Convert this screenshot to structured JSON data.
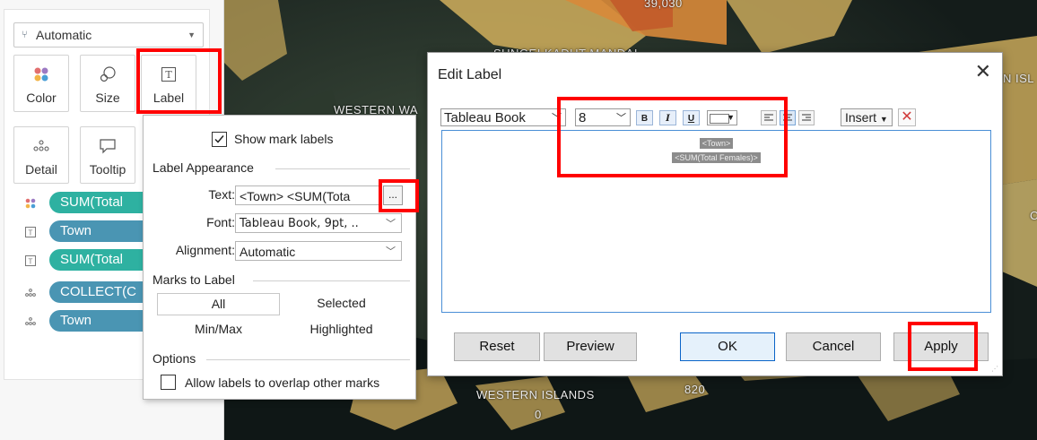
{
  "marks_card": {
    "mark_type": "Automatic",
    "shelves": [
      {
        "label": "Color",
        "icon": "color-dots-icon"
      },
      {
        "label": "Size",
        "icon": "size-icon"
      },
      {
        "label": "Label",
        "icon": "label-text-icon"
      },
      {
        "label": "Detail",
        "icon": "detail-dots-icon"
      },
      {
        "label": "Tooltip",
        "icon": "tooltip-speech-icon"
      }
    ],
    "pills": [
      {
        "text": "SUM(Total",
        "icon": "color-dots-icon",
        "color": "#2eb1a1"
      },
      {
        "text": "Town",
        "icon": "label-text-icon",
        "color": "#4a95b3"
      },
      {
        "text": "SUM(Total",
        "icon": "label-text-icon",
        "color": "#2eb1a1"
      },
      {
        "text": "COLLECT(C",
        "icon": "detail-dots-icon",
        "color": "#4a95b3"
      },
      {
        "text": "Town",
        "icon": "detail-dots-icon",
        "color": "#4a95b3"
      }
    ]
  },
  "label_popup": {
    "show_mark_labels": "Show mark labels",
    "show_mark_labels_checked": true,
    "label_appearance": "Label Appearance",
    "text_label": "Text:",
    "text_value": "<Town> <SUM(Tota",
    "ellipsis": "...",
    "font_label": "Font:",
    "font_value": "Tableau Book, 9pt, ..",
    "alignment_label": "Alignment:",
    "alignment_value": "Automatic",
    "marks_to_label": "Marks to Label",
    "options_grid": [
      "All",
      "Selected",
      "Min/Max",
      "Highlighted"
    ],
    "selected_option": "All",
    "options_header": "Options",
    "allow_overlap": "Allow labels to overlap other marks",
    "allow_overlap_checked": false
  },
  "map": {
    "labels": [
      {
        "text": "39,030"
      },
      {
        "text": "SUNGEI KADUT   MANDAI"
      },
      {
        "text": "WESTERN WA"
      },
      {
        "text": "N ISL"
      },
      {
        "text": "WESTERN ISLANDS"
      },
      {
        "text": "820"
      },
      {
        "text": "0"
      },
      {
        "text": "C"
      }
    ]
  },
  "edit_label_dialog": {
    "title": "Edit Label",
    "close_icon": "close-icon",
    "font_name": "Tableau Book",
    "font_size": "8",
    "bold": "B",
    "italic": "I",
    "underline": "U",
    "insert": "Insert",
    "content_line1": "<Town>",
    "content_line2": "<SUM(Total Females)>",
    "buttons": {
      "reset": "Reset",
      "preview": "Preview",
      "ok": "OK",
      "cancel": "Cancel",
      "apply": "Apply"
    }
  },
  "colors": {
    "highlight": "#ff0000",
    "pill_green": "#2eb1a1",
    "pill_blue": "#4a95b3",
    "dialog_border_accent": "#0a64c8"
  }
}
